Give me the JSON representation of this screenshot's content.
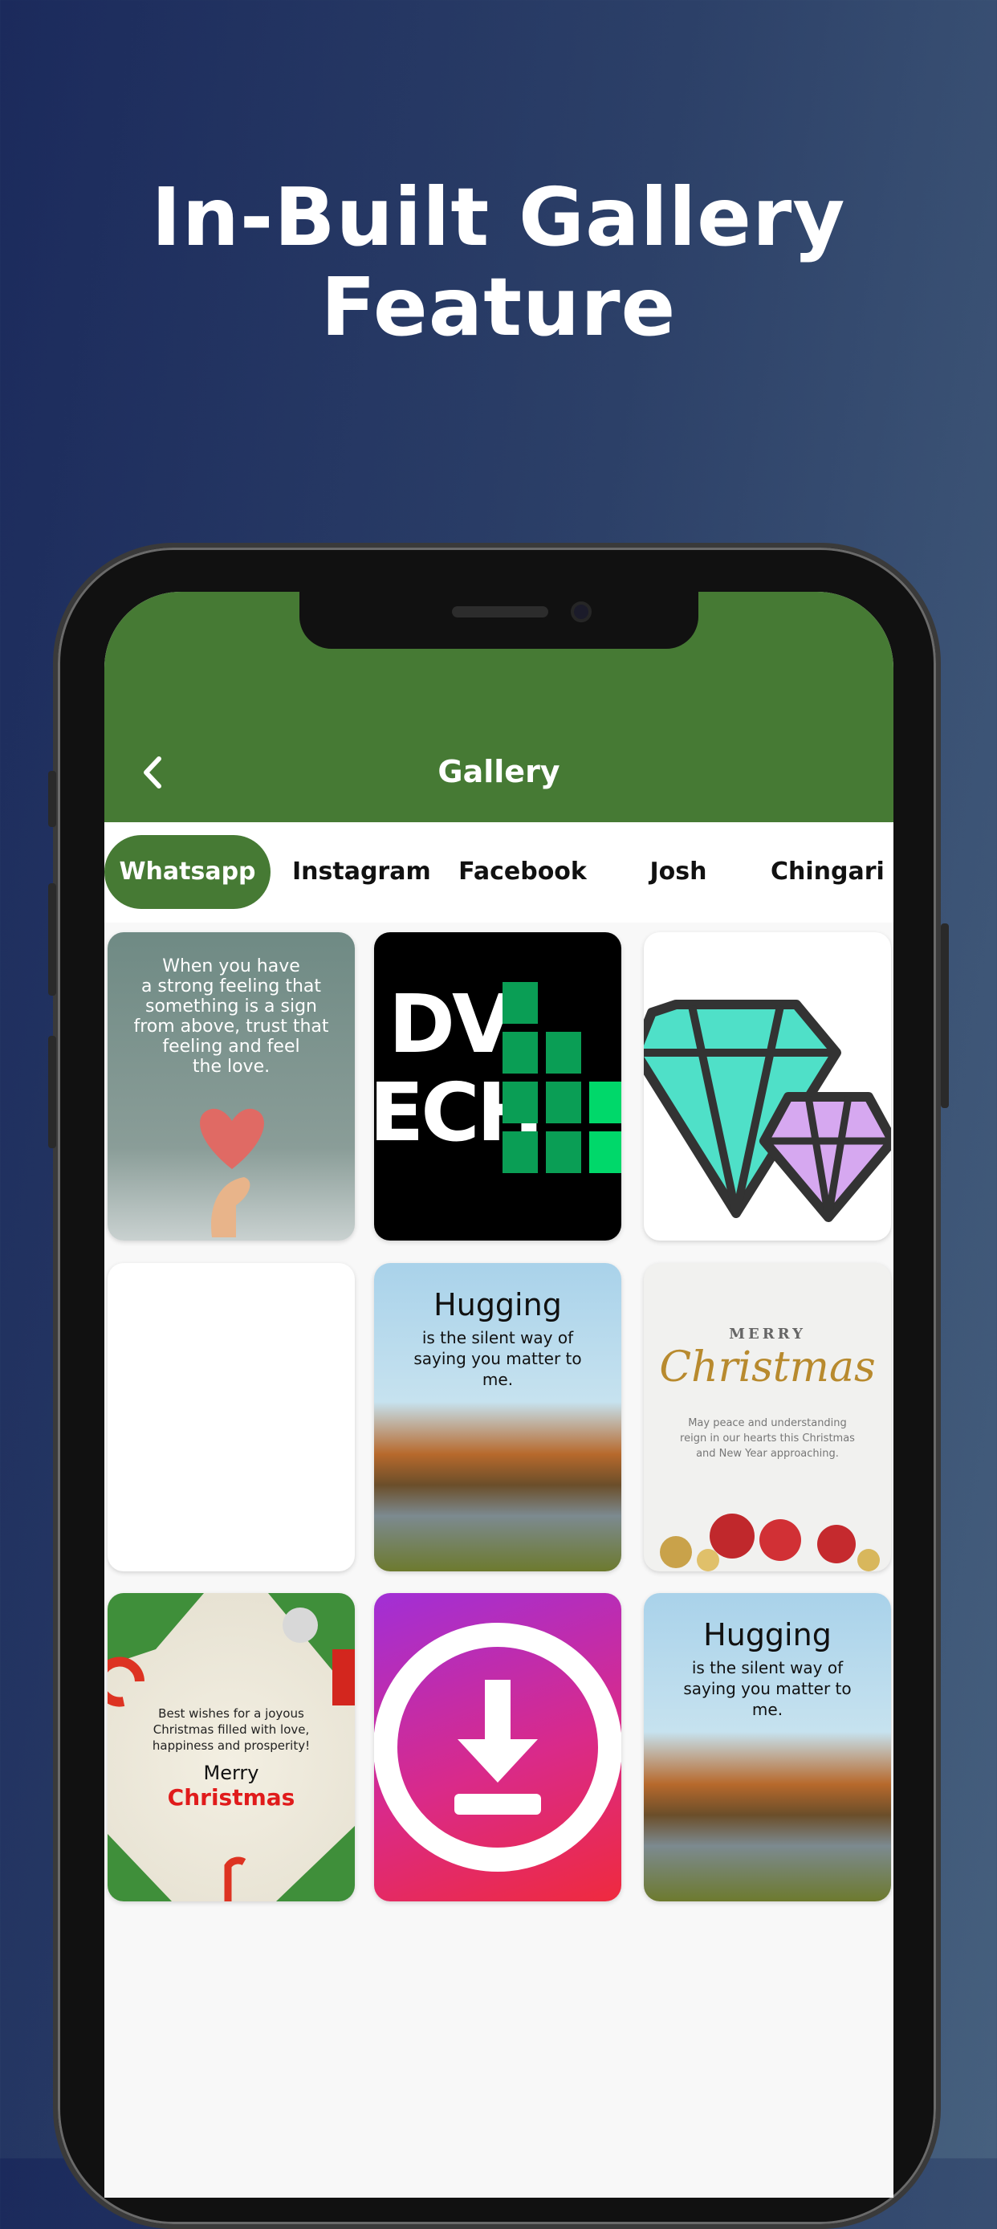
{
  "headline": {
    "line1": "In-Built Gallery",
    "line2": "Feature"
  },
  "app": {
    "title": "Gallery",
    "accent": "#467a34"
  },
  "tabs": [
    {
      "label": "Whatsapp",
      "active": true
    },
    {
      "label": "Instagram"
    },
    {
      "label": "Facebook"
    },
    {
      "label": "Josh"
    },
    {
      "label": "Chingari"
    }
  ],
  "gallery": {
    "quote1": [
      "When you have",
      "a strong feeling that",
      "something is a sign",
      "from above, trust that",
      "feeling and feel",
      "the love."
    ],
    "logo": {
      "line1": "DV",
      "line2": "ECH"
    },
    "hug": {
      "title": "Hugging",
      "subtitle": "is the silent way of saying you matter to me."
    },
    "xmas1": {
      "merry": "MERRY",
      "christmas": "Christmas",
      "text": "May peace and understanding reign in our hearts this Christmas and New Year approaching."
    },
    "xmas2": {
      "text": "Best wishes for a joyous Christmas filled with love, happiness and prosperity!",
      "merry": "Merry",
      "christmas": "Christmas"
    }
  }
}
